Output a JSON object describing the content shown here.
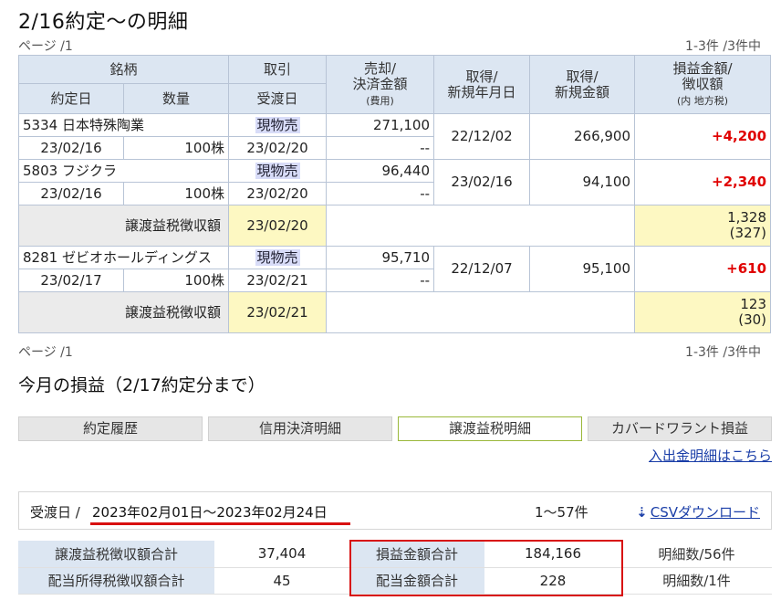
{
  "page_title": "2/16約定～の明細",
  "pager": {
    "left": "ページ /1",
    "right": "1-3件 /3件中"
  },
  "table_headers": {
    "stock": "銘柄",
    "trade": "取引",
    "sale_line1": "売却/",
    "sale_line2": "決済金額",
    "sale_line3": "(費用)",
    "acq_date_line1": "取得/",
    "acq_date_line2": "新規年月日",
    "acq_amount_line1": "取得/",
    "acq_amount_line2": "新規金額",
    "pnl_line1": "損益金額/",
    "pnl_line2": "徴収額",
    "pnl_line3": "(内 地方税)",
    "contract_date": "約定日",
    "quantity": "数量",
    "settle_date": "受渡日"
  },
  "trades": [
    {
      "name": "5334 日本特殊陶業",
      "type": "現物売",
      "sale": "271,100",
      "cost": "--",
      "acq_date": "22/12/02",
      "acq_amount": "266,900",
      "pnl": "+4,200",
      "contract_date": "23/02/16",
      "qty": "100株",
      "settle_date": "23/02/20"
    },
    {
      "name": "5803 フジクラ",
      "type": "現物売",
      "sale": "96,440",
      "cost": "--",
      "acq_date": "23/02/16",
      "acq_amount": "94,100",
      "pnl": "+2,340",
      "contract_date": "23/02/16",
      "qty": "100株",
      "settle_date": "23/02/20"
    },
    {
      "name": "8281 ゼビオホールディングス",
      "type": "現物売",
      "sale": "95,710",
      "cost": "--",
      "acq_date": "22/12/07",
      "acq_amount": "95,100",
      "pnl": "+610",
      "contract_date": "23/02/17",
      "qty": "100株",
      "settle_date": "23/02/21"
    }
  ],
  "tax_rows": [
    {
      "label": "譲渡益税徴収額",
      "date": "23/02/20",
      "amount": "1,328",
      "local": "(327)"
    },
    {
      "label": "譲渡益税徴収額",
      "date": "23/02/21",
      "amount": "123",
      "local": "(30)"
    }
  ],
  "section_title": "今月の損益（2/17約定分まで）",
  "tabs": [
    {
      "label": "約定履歴"
    },
    {
      "label": "信用決済明細"
    },
    {
      "label": "譲渡益税明細"
    },
    {
      "label": "カバードワラント損益"
    }
  ],
  "deposit_link": "入出金明細はこちら",
  "date_bar": {
    "label": "受渡日 /",
    "range": "2023年02月01日～2023年02月24日",
    "count": "1～57件",
    "csv": "CSVダウンロード"
  },
  "summary": [
    {
      "label1": "譲渡益税徴収額合計",
      "value1": "37,404",
      "label2": "損益金額合計",
      "value2": "184,166",
      "meta": "明細数/56件"
    },
    {
      "label1": "配当所得税徴収額合計",
      "value1": "45",
      "label2": "配当金額合計",
      "value2": "228",
      "meta": "明細数/1件"
    }
  ],
  "colors": {
    "header_bg": "#dce6f2",
    "profit": "#e00000",
    "highlight_box": "#d81010",
    "tax_cell": "#fdf8c2",
    "link": "#1a3ea8"
  }
}
